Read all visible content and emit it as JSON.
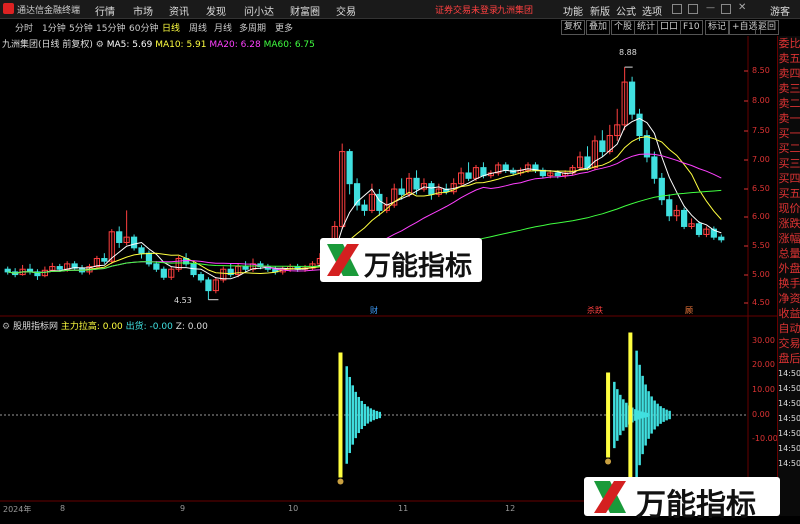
{
  "titlebar": {
    "app": "通达信金融终端",
    "menus": [
      "行情",
      "市场",
      "资讯",
      "发现",
      "问小达",
      "财富圈",
      "交易"
    ],
    "status": "证券交易未登录",
    "stock": "九洲集团",
    "right": [
      "功能",
      "新版",
      "公式",
      "选项"
    ],
    "guest": "游客"
  },
  "periods": [
    "分时",
    "1分钟",
    "5分钟",
    "15分钟",
    "60分钟",
    "日线",
    "周线",
    "月线",
    "多周期",
    "更多"
  ],
  "active_period": "日线",
  "toolbuttons": [
    "复权",
    "叠加",
    "个股",
    "统计",
    "口口",
    "F10",
    "标记",
    "+自选",
    "返回"
  ],
  "stock_legend": {
    "name": "九洲集团(日线 前复权)",
    "ma5": "MA5: 5.69",
    "ma10": "MA10: 5.91",
    "ma20": "MA20: 6.28",
    "ma60": "MA60: 6.75"
  },
  "colors": {
    "up": "#ff4040",
    "down": "#40e0e0",
    "ma5": "#ffffff",
    "ma10": "#ffff40",
    "ma20": "#ff40ff",
    "ma60": "#40ff40"
  },
  "side_items": [
    "委比",
    "卖五",
    "卖四",
    "卖三",
    "卖二",
    "卖一",
    "买一",
    "买二",
    "买三",
    "买四",
    "买五",
    "现价",
    "涨跌",
    "涨幅",
    "总量",
    "外盘",
    "换手",
    "净资",
    "收益",
    "自动",
    "交易",
    "盘后",
    "14:50",
    "14:50",
    "14:50",
    "14:50",
    "14:50",
    "14:50",
    "14:50"
  ],
  "price_axis": [
    "8.50",
    "8.00",
    "7.50",
    "7.00",
    "6.50",
    "6.00",
    "5.50",
    "5.00",
    "4.50"
  ],
  "price_annotations": {
    "high": "8.88",
    "low": "4.53"
  },
  "event_markers": [
    "财",
    "杀跌",
    "顾"
  ],
  "indicator_legend": {
    "name": "股朋指标网",
    "a": "主力拉高: 0.00",
    "b": "出货: -0.00",
    "c": "Z: 0.00"
  },
  "ind_axis": [
    "30.00",
    "20.00",
    "10.00",
    "0.00",
    "-10.00"
  ],
  "x_axis": [
    "2024年",
    "8",
    "9",
    "10",
    "11",
    "12"
  ],
  "watermark": "万能指标",
  "chart_data": {
    "type": "candlestick",
    "ylim": [
      4.3,
      9.2
    ],
    "note_series": [
      "MA5",
      "MA10",
      "MA20",
      "MA60"
    ],
    "candles": [
      [
        5.1,
        5.05,
        5.15,
        5.0
      ],
      [
        5.05,
        5.0,
        5.12,
        4.95
      ],
      [
        5.0,
        5.1,
        5.18,
        4.98
      ],
      [
        5.1,
        5.05,
        5.2,
        5.0
      ],
      [
        5.05,
        4.98,
        5.1,
        4.9
      ],
      [
        4.98,
        5.08,
        5.15,
        4.95
      ],
      [
        5.08,
        5.15,
        5.22,
        5.05
      ],
      [
        5.15,
        5.1,
        5.2,
        5.05
      ],
      [
        5.1,
        5.2,
        5.25,
        5.05
      ],
      [
        5.2,
        5.12,
        5.25,
        5.08
      ],
      [
        5.12,
        5.05,
        5.18,
        5.0
      ],
      [
        5.05,
        5.15,
        5.2,
        5.0
      ],
      [
        5.15,
        5.3,
        5.35,
        5.1
      ],
      [
        5.3,
        5.25,
        5.4,
        5.2
      ],
      [
        5.25,
        5.8,
        5.85,
        5.2
      ],
      [
        5.8,
        5.6,
        5.9,
        5.5
      ],
      [
        5.6,
        5.7,
        6.2,
        5.55
      ],
      [
        5.7,
        5.5,
        5.75,
        5.45
      ],
      [
        5.5,
        5.4,
        5.55,
        5.3
      ],
      [
        5.4,
        5.2,
        5.45,
        5.15
      ],
      [
        5.2,
        5.1,
        5.25,
        5.05
      ],
      [
        5.1,
        4.95,
        5.15,
        4.9
      ],
      [
        4.95,
        5.1,
        5.15,
        4.9
      ],
      [
        5.1,
        5.3,
        5.35,
        5.05
      ],
      [
        5.3,
        5.2,
        5.4,
        5.15
      ],
      [
        5.2,
        5.0,
        5.25,
        4.95
      ],
      [
        5.0,
        4.9,
        5.05,
        4.85
      ],
      [
        4.9,
        4.7,
        4.95,
        4.53
      ],
      [
        4.7,
        4.9,
        4.95,
        4.65
      ],
      [
        4.9,
        5.1,
        5.15,
        4.85
      ],
      [
        5.1,
        5.0,
        5.2,
        4.95
      ],
      [
        5.0,
        5.15,
        5.2,
        4.95
      ],
      [
        5.15,
        5.1,
        5.25,
        5.05
      ],
      [
        5.1,
        5.2,
        5.3,
        5.05
      ],
      [
        5.2,
        5.15,
        5.25,
        5.1
      ],
      [
        5.15,
        5.1,
        5.2,
        5.05
      ],
      [
        5.1,
        5.05,
        5.15,
        5.0
      ],
      [
        5.05,
        5.1,
        5.15,
        5.0
      ],
      [
        5.1,
        5.15,
        5.2,
        5.05
      ],
      [
        5.15,
        5.1,
        5.2,
        5.05
      ],
      [
        5.1,
        5.12,
        5.18,
        5.05
      ],
      [
        5.12,
        5.2,
        5.25,
        5.08
      ],
      [
        5.2,
        5.3,
        5.4,
        5.15
      ],
      [
        5.3,
        5.6,
        5.65,
        5.25
      ],
      [
        5.6,
        5.9,
        6.0,
        5.55
      ],
      [
        5.9,
        7.3,
        7.45,
        5.85
      ],
      [
        7.3,
        6.7,
        7.35,
        6.5
      ],
      [
        6.7,
        6.3,
        6.8,
        6.2
      ],
      [
        6.3,
        6.2,
        6.4,
        6.1
      ],
      [
        6.2,
        6.5,
        6.7,
        6.15
      ],
      [
        6.5,
        6.2,
        6.6,
        6.1
      ],
      [
        6.2,
        6.3,
        6.45,
        6.15
      ],
      [
        6.3,
        6.6,
        6.7,
        6.25
      ],
      [
        6.6,
        6.5,
        6.8,
        6.4
      ],
      [
        6.5,
        6.8,
        6.9,
        6.45
      ],
      [
        6.8,
        6.6,
        6.95,
        6.5
      ],
      [
        6.6,
        6.7,
        6.8,
        6.55
      ],
      [
        6.7,
        6.5,
        6.75,
        6.4
      ],
      [
        6.5,
        6.6,
        6.7,
        6.45
      ],
      [
        6.6,
        6.55,
        6.7,
        6.5
      ],
      [
        6.55,
        6.7,
        6.8,
        6.5
      ],
      [
        6.7,
        6.9,
        7.0,
        6.65
      ],
      [
        6.9,
        6.8,
        7.1,
        6.75
      ],
      [
        6.8,
        7.0,
        7.05,
        6.75
      ],
      [
        7.0,
        6.85,
        7.1,
        6.8
      ],
      [
        6.85,
        6.9,
        6.95,
        6.8
      ],
      [
        6.9,
        7.05,
        7.1,
        6.85
      ],
      [
        7.05,
        6.95,
        7.1,
        6.9
      ],
      [
        6.95,
        6.9,
        7.0,
        6.85
      ],
      [
        6.9,
        6.95,
        7.0,
        6.85
      ],
      [
        6.95,
        7.05,
        7.1,
        6.9
      ],
      [
        7.05,
        6.95,
        7.1,
        6.9
      ],
      [
        6.95,
        6.85,
        7.0,
        6.8
      ],
      [
        6.85,
        6.9,
        6.95,
        6.8
      ],
      [
        6.9,
        6.85,
        6.95,
        6.8
      ],
      [
        6.85,
        6.9,
        6.95,
        6.8
      ],
      [
        6.9,
        7.0,
        7.05,
        6.85
      ],
      [
        7.0,
        7.2,
        7.3,
        6.95
      ],
      [
        7.2,
        7.0,
        7.4,
        6.95
      ],
      [
        7.0,
        7.5,
        7.6,
        6.95
      ],
      [
        7.5,
        7.3,
        7.7,
        7.2
      ],
      [
        7.3,
        7.6,
        7.8,
        7.25
      ],
      [
        7.6,
        7.8,
        8.1,
        7.5
      ],
      [
        7.8,
        8.6,
        8.88,
        7.7
      ],
      [
        8.6,
        8.0,
        8.7,
        7.9
      ],
      [
        8.0,
        7.6,
        8.1,
        7.5
      ],
      [
        7.6,
        7.2,
        7.7,
        7.1
      ],
      [
        7.2,
        6.8,
        7.3,
        6.7
      ],
      [
        6.8,
        6.4,
        6.9,
        6.3
      ],
      [
        6.4,
        6.1,
        6.5,
        6.0
      ],
      [
        6.1,
        6.2,
        6.3,
        6.0
      ],
      [
        6.2,
        5.9,
        6.25,
        5.85
      ],
      [
        5.9,
        5.95,
        6.05,
        5.85
      ],
      [
        5.95,
        5.75,
        6.0,
        5.7
      ],
      [
        5.75,
        5.85,
        5.9,
        5.7
      ],
      [
        5.85,
        5.7,
        5.9,
        5.65
      ],
      [
        5.7,
        5.65,
        5.75,
        5.6
      ]
    ],
    "indicator_spikes": [
      {
        "at": 45,
        "height": 25
      },
      {
        "at": 81,
        "height": 17
      },
      {
        "at": 84,
        "height": 33
      }
    ]
  }
}
